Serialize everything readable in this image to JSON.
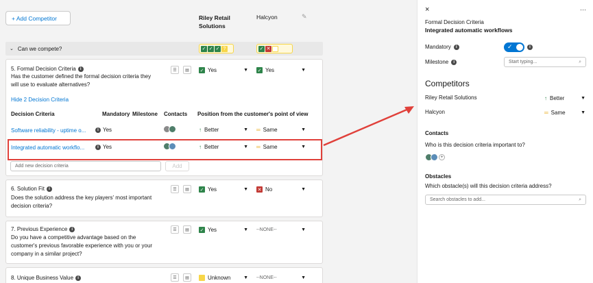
{
  "top": {
    "add_competitor": "+ Add Competitor",
    "competitor1": "Riley Retail",
    "competitor1_line2": "Solutions",
    "competitor2": "Halcyon"
  },
  "section": {
    "title": "Can we compete?"
  },
  "q5": {
    "title": "5. Formal Decision Criteria",
    "text1": "Has the customer defined the formal decision criteria they",
    "text2": "will use to evaluate alternatives?",
    "answer1": "Yes",
    "answer2": "Yes",
    "hide_link": "Hide 2 Decision Criteria",
    "headers": {
      "criteria": "Decision Criteria",
      "mandatory": "Mandatory",
      "milestone": "Milestone",
      "contacts": "Contacts",
      "position": "Position from the customer's point of view"
    },
    "rows": [
      {
        "name": "Software reliability - uptime o...",
        "mandatory": "Yes",
        "pos1": "Better",
        "pos2": "Same"
      },
      {
        "name": "Integrated automatic workflo...",
        "mandatory": "Yes",
        "pos1": "Better",
        "pos2": "Same"
      }
    ],
    "new_placeholder": "Add new decision criteria",
    "add_label": "Add"
  },
  "q6": {
    "title": "6. Solution Fit",
    "text1": "Does the solution address the key players' most important",
    "text2": "decision criteria?",
    "answer1": "Yes",
    "answer2": "No"
  },
  "q7": {
    "title": "7. Previous Experience",
    "text1": "Do you have a competitive advantage based on the",
    "text2": "customer's previous favorable experience with you or your",
    "text3": "company in a similar project?",
    "answer1": "Yes",
    "answer2": "--NONE--"
  },
  "q8": {
    "title": "8. Unique Business Value",
    "answer1": "Unknown",
    "answer2": "--NONE--"
  },
  "panel": {
    "close": "×",
    "more": "···",
    "subtitle": "Formal Decision Criteria",
    "title": "Integrated automatic workflows",
    "mandatory_label": "Mandatory",
    "milestone_label": "Milestone",
    "milestone_placeholder": "Start typing...",
    "competitors_heading": "Competitors",
    "comp1": "Riley Retail Solutions",
    "comp1_value": "Better",
    "comp2": "Halcyon",
    "comp2_value": "Same",
    "contacts_heading": "Contacts",
    "contacts_question": "Who is this decision criteria important to?",
    "obstacles_heading": "Obstacles",
    "obstacles_question": "Which obstacle(s) will this decision criteria address?",
    "obstacles_placeholder": "Search obstacles to add..."
  },
  "colors": {
    "accent": "#0176d3",
    "highlight": "#e0403a",
    "green": "#2e844a",
    "yellow": "#f7d649",
    "red": "#c23934"
  }
}
